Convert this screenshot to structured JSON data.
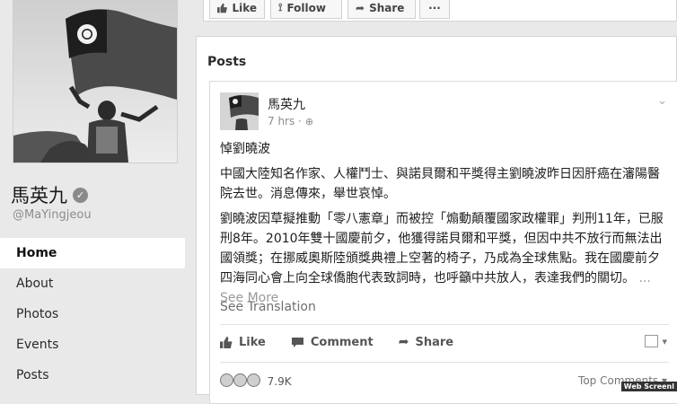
{
  "profile": {
    "name": "馬英九",
    "handle": "@MaYingjeou",
    "nav": [
      {
        "label": "Home",
        "active": true
      },
      {
        "label": "About",
        "active": false
      },
      {
        "label": "Photos",
        "active": false
      },
      {
        "label": "Events",
        "active": false
      },
      {
        "label": "Posts",
        "active": false
      }
    ]
  },
  "topbar": {
    "like": "Like",
    "follow": "Follow",
    "share": "Share",
    "more": "···"
  },
  "posts_section": {
    "title": "Posts"
  },
  "post": {
    "author": "馬英九",
    "time": "7 hrs ·",
    "title": "悼劉曉波",
    "paragraph1": "中國大陸知名作家、人權鬥士、與諾貝爾和平獎得主劉曉波昨日因肝癌在瀋陽醫院去世。消息傳來，舉世哀悼。",
    "paragraph2": "劉曉波因草擬推動「零八憲章」而被控「煽動顛覆國家政權罪」判刑11年，已服刑8年。2010年雙十國慶前夕，他獲得諾貝爾和平獎，但因中共不放行而無法出國領獎；在挪威奧斯陸頒獎典禮上空著的椅子，乃成為全球焦點。我在國慶前夕四海同心會上向全球僑胞代表致詞時，也呼籲中共放人，表達我們的關切。",
    "see_more": "... See More",
    "see_translation": "See Translation",
    "actions": {
      "like": "Like",
      "comment": "Comment",
      "share": "Share"
    },
    "reaction_count": "7.9K",
    "top_comments": "Top Comments ▾"
  },
  "watermark": "Web Screenl"
}
